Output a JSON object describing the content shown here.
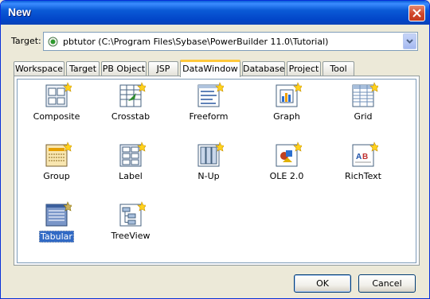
{
  "window": {
    "title": "New"
  },
  "target": {
    "label": "Target:",
    "value": "pbtutor (C:\\Program Files\\Sybase\\PowerBuilder 11.0\\Tutorial)"
  },
  "tabs": [
    {
      "label": "Workspace"
    },
    {
      "label": "Target"
    },
    {
      "label": "PB Object"
    },
    {
      "label": "JSP"
    },
    {
      "label": "DataWindow",
      "active": true
    },
    {
      "label": "Database"
    },
    {
      "label": "Project"
    },
    {
      "label": "Tool"
    }
  ],
  "items": [
    {
      "label": "Composite",
      "icon": "composite-icon"
    },
    {
      "label": "Crosstab",
      "icon": "crosstab-icon"
    },
    {
      "label": "Freeform",
      "icon": "freeform-icon"
    },
    {
      "label": "Graph",
      "icon": "graph-icon"
    },
    {
      "label": "Grid",
      "icon": "grid-icon"
    },
    {
      "label": "Group",
      "icon": "group-icon"
    },
    {
      "label": "Label",
      "icon": "label-icon"
    },
    {
      "label": "N-Up",
      "icon": "n-up-icon"
    },
    {
      "label": "OLE 2.0",
      "icon": "ole-icon"
    },
    {
      "label": "RichText",
      "icon": "richtext-icon"
    },
    {
      "label": "Tabular",
      "icon": "tabular-icon",
      "selected": true
    },
    {
      "label": "TreeView",
      "icon": "treeview-icon"
    }
  ],
  "buttons": {
    "ok": "OK",
    "cancel": "Cancel"
  },
  "colors": {
    "titlebar": "#0a5ad6",
    "selection": "#316ac5",
    "tab_highlight": "#ffc83c",
    "face": "#ece9d8"
  }
}
